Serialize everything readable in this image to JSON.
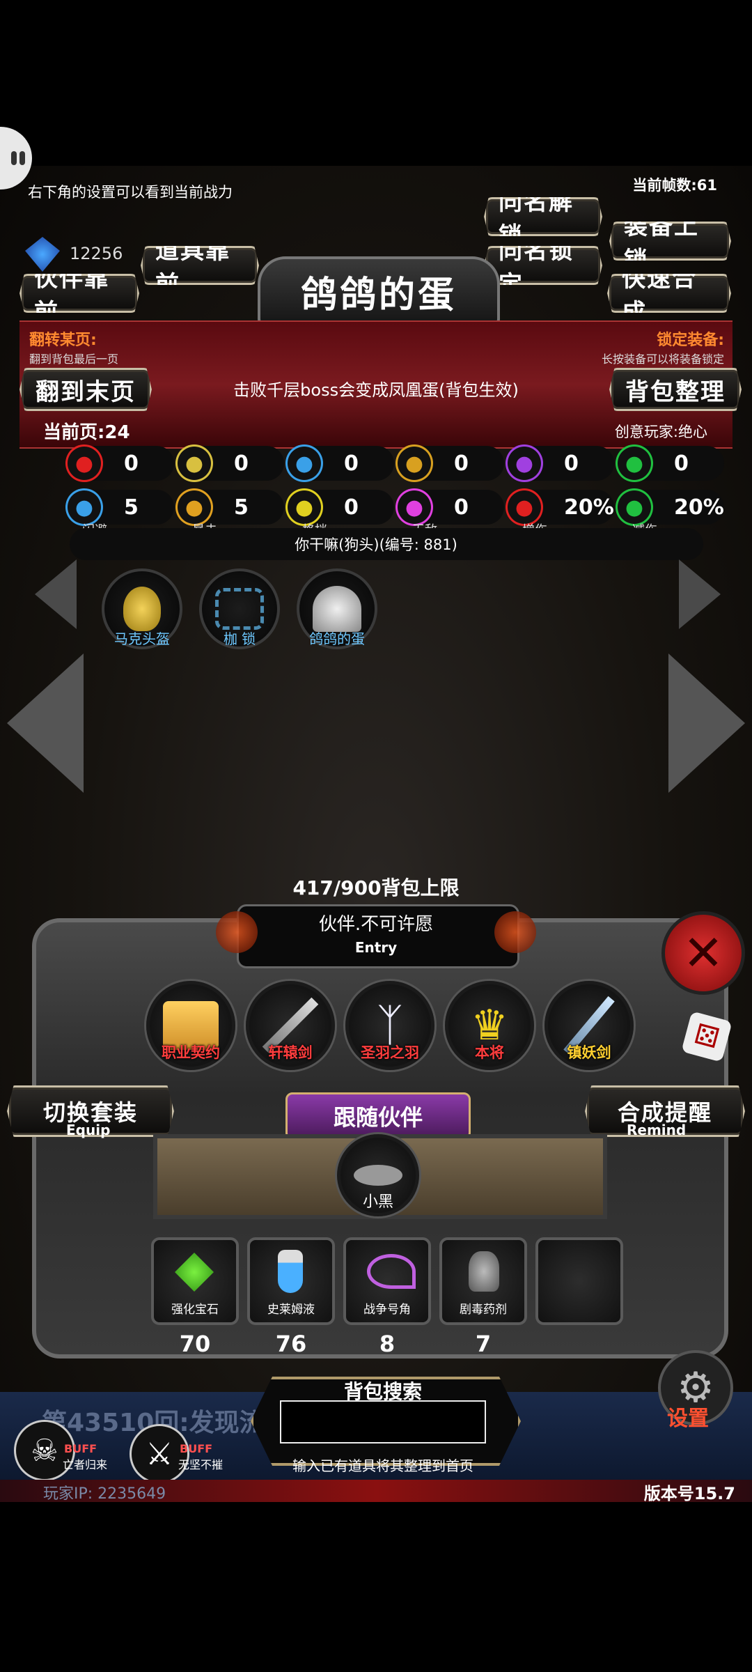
{
  "hud": {
    "tip": "右下角的设置可以看到当前战力",
    "fps": "当前帧数:61",
    "gems": "12256",
    "current_page": "当前页:24",
    "creative_player": "创意玩家:绝心",
    "flip_label": "翻转某页:",
    "flip_hint": "翻到背包最后一页",
    "lock_label": "锁定装备:",
    "lock_hint": "长按装备可以将装备锁定"
  },
  "buttons": {
    "same_unlock": "同名解锁",
    "equip_lock": "装备上锁",
    "props_front": "道具靠前",
    "same_lock": "同名锁定",
    "partner_front": "伙伴靠前",
    "quick_merge": "快速合成",
    "go_last_page": "翻到末页",
    "bag_sort": "背包整理",
    "switch_set": "切换套装",
    "switch_set_sub": "Equip",
    "merge_remind": "合成提醒",
    "merge_remind_sub": "Remind"
  },
  "item": {
    "title": "鸽鸽的蛋",
    "description": "击败千层boss会变成凤凰蛋(背包生效)",
    "owner_line": "你干嘛(狗头)(编号: 881)"
  },
  "stats_row1": [
    {
      "icon": "heart-icon",
      "value": "0",
      "color": "#e02020"
    },
    {
      "icon": "strength-icon",
      "value": "0",
      "color": "#d8c040"
    },
    {
      "icon": "helmet-icon",
      "value": "0",
      "color": "#3aa0e8"
    },
    {
      "icon": "sword-icon",
      "value": "0",
      "color": "#d8a020"
    },
    {
      "icon": "lightning-icon",
      "value": "0",
      "color": "#a040e0"
    },
    {
      "icon": "clover-icon",
      "value": "0",
      "color": "#20c040"
    }
  ],
  "stats_row2": [
    {
      "icon": "dodge-icon",
      "value": "5",
      "label": "闪避",
      "color": "#3aa0e8"
    },
    {
      "icon": "crit-icon",
      "value": "5",
      "label": "暴击",
      "color": "#e0a020"
    },
    {
      "icon": "block-icon",
      "value": "0",
      "label": "格挡",
      "color": "#e0d020"
    },
    {
      "icon": "invincible-icon",
      "value": "0",
      "label": "无敌",
      "color": "#e040e0"
    },
    {
      "icon": "damage-up-icon",
      "value": "20%",
      "label": "增伤",
      "color": "#e02020"
    },
    {
      "icon": "damage-down-icon",
      "value": "20%",
      "label": "减伤",
      "color": "#20c040"
    }
  ],
  "equipped": [
    {
      "name": "马克头盔",
      "icon": "golden-mask-icon"
    },
    {
      "name": "枷 锁",
      "icon": "shackles-icon"
    },
    {
      "name": "鸽鸽的蛋",
      "icon": "egg-icon"
    }
  ],
  "bag_capacity": "417/900背包上限",
  "partner_banner": {
    "title": "伙伴.不可许愿",
    "sub": "Entry"
  },
  "partner_items": [
    {
      "name": "职业契约",
      "icon": "scroll-icon"
    },
    {
      "name": "轩辕剑",
      "icon": "blade-icon"
    },
    {
      "name": "圣羽之羽",
      "icon": "wings-icon"
    },
    {
      "name": "本将",
      "icon": "crown-icon"
    },
    {
      "name": "镇妖剑",
      "icon": "ice-sword-icon"
    }
  ],
  "follow_partner": {
    "title": "跟随伙伴",
    "pet": "小黑"
  },
  "bag_items": [
    {
      "name": "强化宝石",
      "count": "70",
      "icon": "green-gem-icon"
    },
    {
      "name": "史莱姆液",
      "count": "76",
      "icon": "potion-icon"
    },
    {
      "name": "战争号角",
      "count": "8",
      "icon": "horn-icon"
    },
    {
      "name": "剧毒药剂",
      "count": "7",
      "icon": "poison-icon"
    }
  ],
  "search": {
    "title": "背包搜索",
    "hint": "输入已有道具将其整理到首页",
    "value": ""
  },
  "footer": {
    "round": "第43510回:发现流",
    "buff1_tag": "BUFF",
    "buff1": "亡者归来",
    "buff2_tag": "BUFF",
    "buff2": "无坚不摧",
    "settings": "设置",
    "player_ip": "玩家IP: 2235649",
    "version": "版本号15.7"
  }
}
